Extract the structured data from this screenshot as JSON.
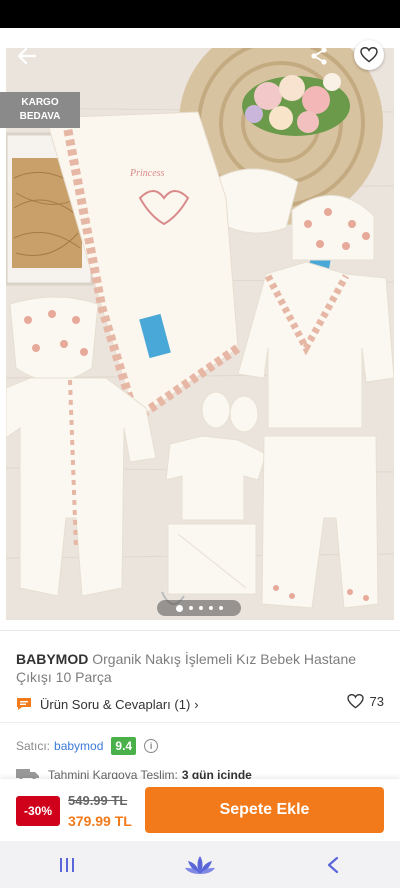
{
  "product": {
    "cargo_badge": [
      "KARGO",
      "BEDAVA"
    ],
    "brand": "BABYMOD",
    "name": "Organik Nakış İşlemeli Kız Bebek Hastane Çıkışı 10 Parça",
    "image_count": 5,
    "active_image_index": 0
  },
  "qa": {
    "label": "Ürün Soru & Cevapları (1)",
    "chevron": "›",
    "favorite_count": "73"
  },
  "seller": {
    "label": "Satıcı:",
    "name": "babymod",
    "score": "9.4",
    "info_symbol": "i"
  },
  "delivery": {
    "label": "Tahmini Kargoya Teslim:",
    "value": "3 gün içinde"
  },
  "price": {
    "discount": "-30%",
    "old": "549.99 TL",
    "new": "379.99 TL"
  },
  "cart_button": "Sepete Ekle",
  "icons": {
    "back": "arrow-left-icon",
    "share": "share-icon",
    "favorite": "heart-outline-icon",
    "qa": "chat-bubble-icon",
    "info": "info-icon",
    "truck": "truck-icon",
    "nav_recent": "recent-apps-icon",
    "nav_home": "lotus-home-icon",
    "nav_back": "chevron-left-icon"
  },
  "colors": {
    "accent": "#f27a1a",
    "discount_badge": "#d0021b",
    "seller_link": "#3d7bd9",
    "score_badge": "#4ab04a",
    "nav_lotus": "#5b67d8"
  }
}
